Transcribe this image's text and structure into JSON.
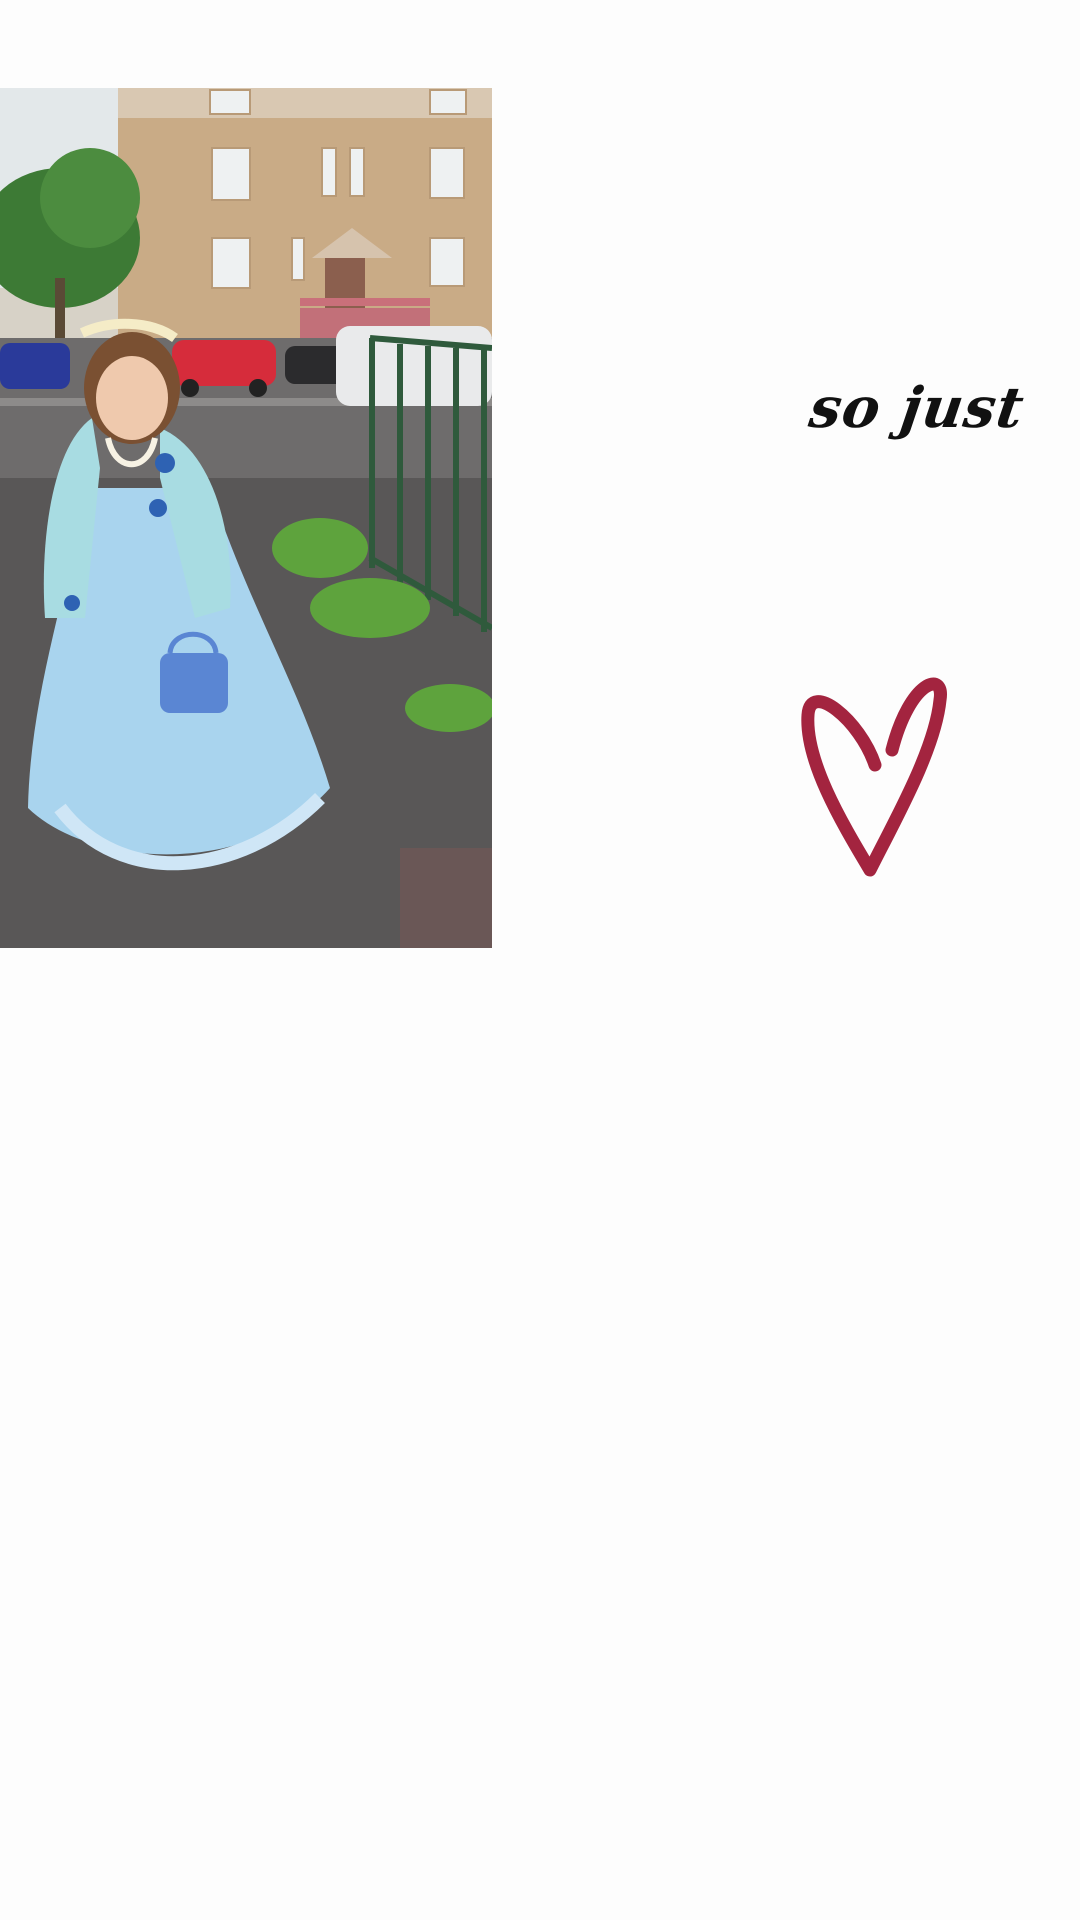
{
  "story": {
    "caption_text": "so just",
    "sticker": "heart-icon",
    "photo_subject": "photo"
  },
  "colors": {
    "background": "#fdfdfd",
    "caption": "#111111",
    "heart": "#a3243f",
    "dress": "#a9d4ee"
  }
}
